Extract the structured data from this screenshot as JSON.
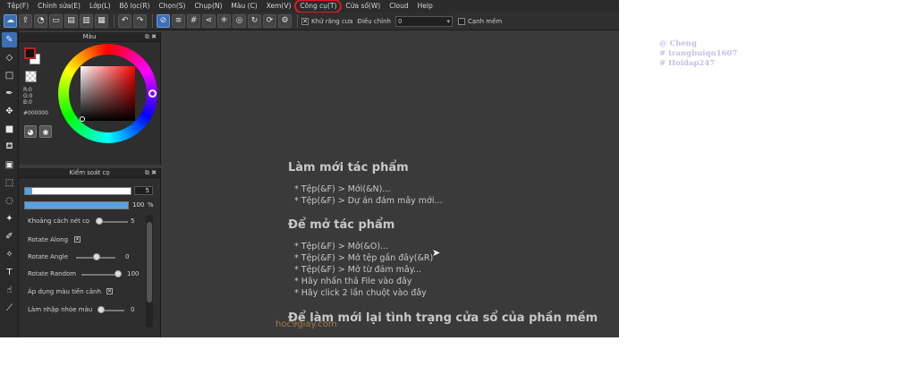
{
  "menubar": {
    "items": [
      "Tệp(F)",
      "Chỉnh sửa(E)",
      "Lớp(L)",
      "Bộ lọc(R)",
      "Chọn(S)",
      "Chụp(N)",
      "Màu (C)",
      "Xem(V)",
      "Công cụ(T)",
      "Cửa số(W)",
      "Cloud",
      "Help"
    ]
  },
  "toolbar": {
    "antialias_label": "Khử răng cưa",
    "adjust_label": "Điều chỉnh",
    "adjust_value": "0",
    "edge_label": "Cạnh mềm"
  },
  "color_panel": {
    "title": "Màu",
    "r": "R:0",
    "g": "G:0",
    "b": "B:0",
    "hex": "#000000"
  },
  "brush_panel": {
    "title": "Kiểm soát cọ",
    "size_value": "5",
    "opacity_value": "100",
    "opacity_unit": "%",
    "opacity_fraction": 1.0,
    "props": {
      "spacing_label": "Khoảng cách nét cọ",
      "spacing_value": "5",
      "rotate_along_label": "Rotate Along",
      "rotate_angle_label": "Rotate Angle",
      "rotate_angle_value": "0",
      "rotate_random_label": "Rotate Random",
      "rotate_random_value": "100",
      "apply_fg_label": "Áp dụng màu tiền cảnh",
      "blur_label": "Làm nhập nhòe màu",
      "blur_value": "0"
    }
  },
  "welcome": {
    "section1_title": "Làm mới tác phẩm",
    "section1_items": [
      "* Tệp(&F) > Mới(&N)...",
      "* Tệp(&F) > Dự án đám mây mới..."
    ],
    "section2_title": "Để mở tác phẩm",
    "section2_items": [
      "* Tệp(&F) > Mở(&O)...",
      "* Tệp(&F) > Mở tệp gần đây(&R)",
      "* Tệp(&F) > Mở từ đám mây...",
      "* Hãy nhấn thả File vào đây",
      "* Hãy click 2 lần chuột vào đây"
    ],
    "section3_title": "Để làm mới lại tình trạng cửa sổ của phần mềm",
    "watermark": "hoc9giay.com"
  },
  "side_tags": [
    "@ Cheng",
    "# trangbuiqn1607",
    "# Hoidap247"
  ]
}
